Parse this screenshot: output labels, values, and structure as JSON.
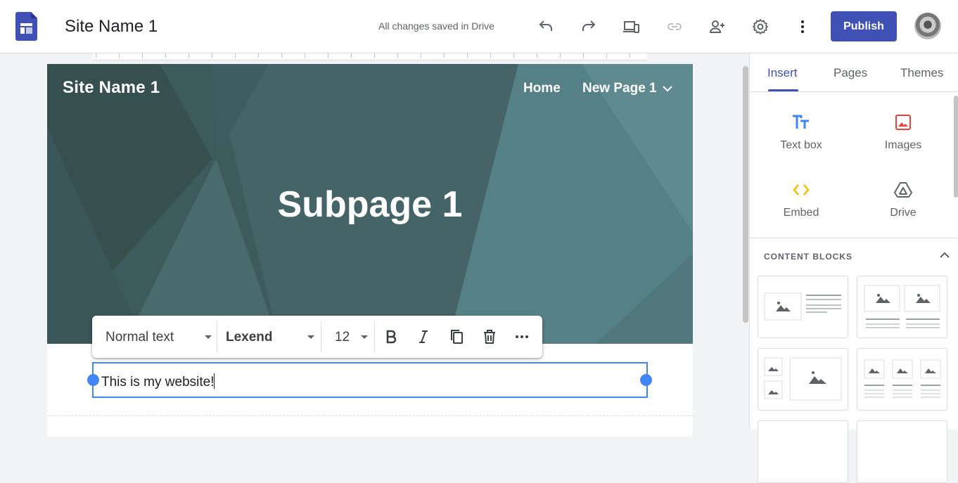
{
  "app": {
    "site_title": "Site Name 1",
    "save_status": "All changes saved in Drive",
    "publish_label": "Publish",
    "accent": "#3f51b5"
  },
  "toolbar_icons": [
    "undo-icon",
    "redo-icon",
    "preview-devices-icon",
    "link-icon",
    "share-add-person-icon",
    "settings-gear-icon",
    "more-vert-icon"
  ],
  "page": {
    "header_site_name": "Site Name 1",
    "nav": {
      "home": "Home",
      "current": "New Page 1"
    },
    "hero_title": "Subpage 1",
    "hero_color": "#4a6a6e"
  },
  "format_toolbar": {
    "style": "Normal text",
    "font": "Lexend",
    "size": "12"
  },
  "textbox": {
    "text": "This is my website!"
  },
  "panel": {
    "tabs": [
      "Insert",
      "Pages",
      "Themes"
    ],
    "active_tab": "Insert",
    "insert_items": [
      {
        "label": "Text box",
        "icon": "text-box-icon",
        "color": "#4285f4"
      },
      {
        "label": "Images",
        "icon": "image-icon",
        "color": "#ea4335"
      },
      {
        "label": "Embed",
        "icon": "embed-code-icon",
        "color": "#fbbc04"
      },
      {
        "label": "Drive",
        "icon": "drive-icon",
        "color": "#5f6368"
      }
    ],
    "content_blocks_title": "CONTENT BLOCKS"
  }
}
